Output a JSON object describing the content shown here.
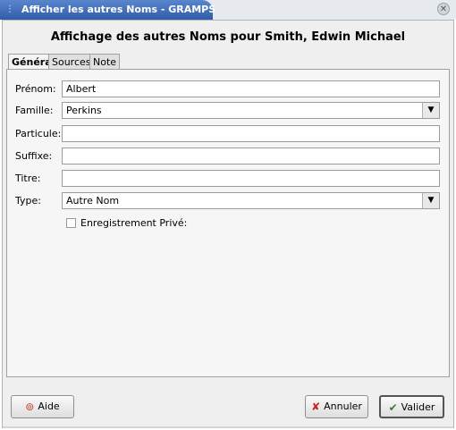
{
  "window": {
    "title": "Afficher les autres Noms - GRAMPS"
  },
  "dialog": {
    "heading": "Affichage des autres Noms pour Smith, Edwin Michael"
  },
  "tabs": [
    {
      "label": "Général"
    },
    {
      "label": "Sources"
    },
    {
      "label": "Note"
    }
  ],
  "form": {
    "prenom": {
      "label": "Prénom:",
      "value": "Albert"
    },
    "famille": {
      "label": "Famille:",
      "value": "Perkins"
    },
    "particule": {
      "label": "Particule:",
      "value": ""
    },
    "suffixe": {
      "label": "Suffixe:",
      "value": ""
    },
    "titre": {
      "label": "Titre:",
      "value": ""
    },
    "type": {
      "label": "Type:",
      "value": "Autre Nom"
    },
    "private": {
      "label": "Enregistrement Privé:",
      "checked": false
    }
  },
  "buttons": {
    "help": "Aide",
    "cancel": "Annuler",
    "ok": "Valider"
  },
  "icons": {
    "help": "lifebuoy-icon",
    "cancel": "red-x-icon",
    "ok": "checkmark-icon",
    "dropdown": "triangle-down-icon",
    "close": "close-icon",
    "menu": "window-menu-icon"
  }
}
